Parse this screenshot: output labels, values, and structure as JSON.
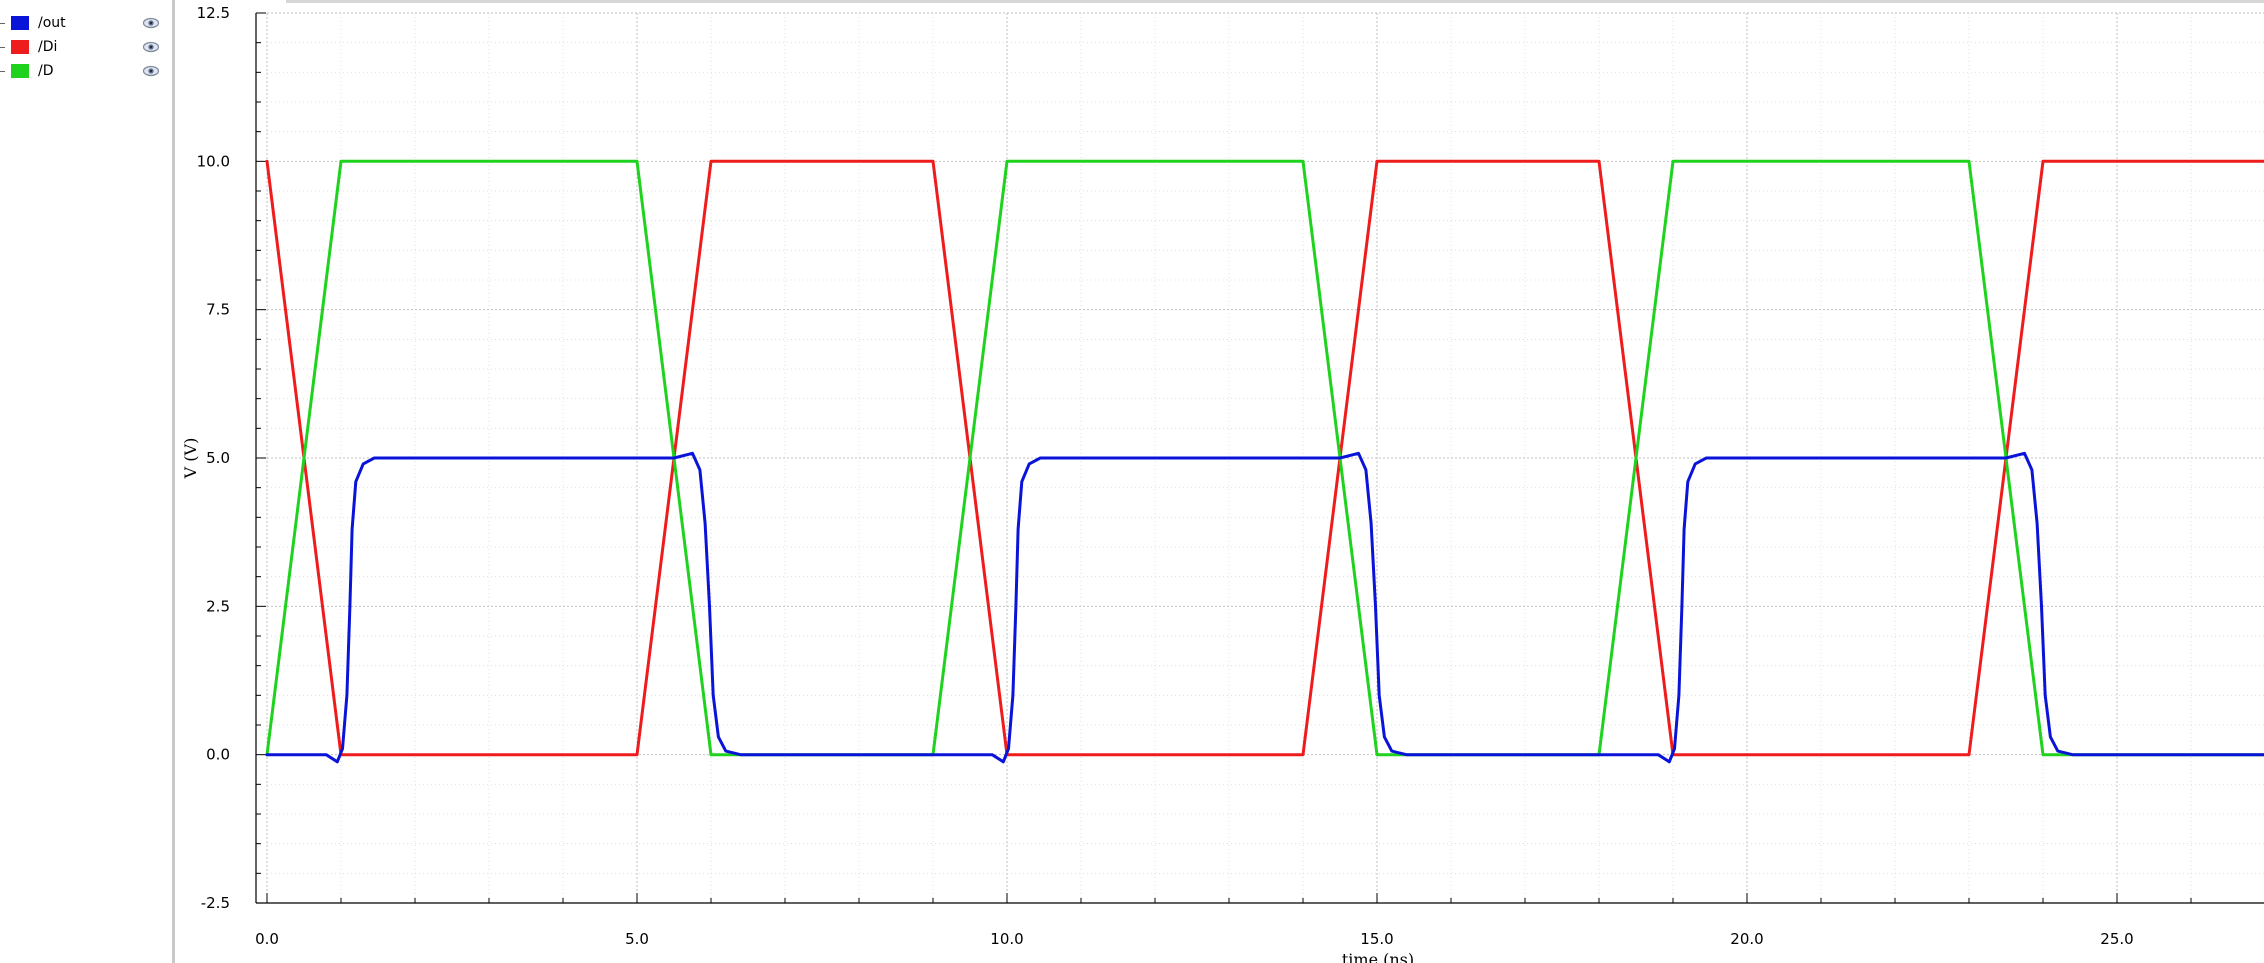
{
  "legend": {
    "items": [
      {
        "label": "/out",
        "color": "#0a14d8",
        "icon": "eye-icon"
      },
      {
        "label": "/Di",
        "color": "#ee1c1c",
        "icon": "eye-icon"
      },
      {
        "label": "/D",
        "color": "#1ed21e",
        "icon": "eye-icon"
      }
    ]
  },
  "chart_data": {
    "type": "line",
    "title": "",
    "xlabel": "time (ns)",
    "ylabel": "V (V)",
    "xlim": [
      0,
      27
    ],
    "ylim": [
      -2.5,
      12.5
    ],
    "x_ticks": [
      0.0,
      5.0,
      10.0,
      15.0,
      20.0,
      25.0
    ],
    "x_tick_labels": [
      "0.0",
      "5.0",
      "10.0",
      "15.0",
      "20.0",
      "25.0"
    ],
    "y_ticks": [
      -2.5,
      0.0,
      2.5,
      5.0,
      7.5,
      10.0,
      12.5
    ],
    "y_tick_labels": [
      "-2.5",
      "0.0",
      "2.5",
      "5.0",
      "7.5",
      "10.0",
      "12.5"
    ],
    "grid": true,
    "legend_position": "left panel",
    "series": [
      {
        "name": "/out",
        "color": "#0a14d8",
        "x": [
          0,
          0.8,
          0.95,
          1.02,
          1.08,
          1.12,
          1.15,
          1.2,
          1.3,
          1.45,
          2.0,
          5.5,
          5.75,
          5.85,
          5.92,
          5.98,
          6.03,
          6.1,
          6.2,
          6.4,
          9.0,
          9.8,
          9.95,
          10.02,
          10.08,
          10.12,
          10.15,
          10.2,
          10.3,
          10.45,
          11.0,
          14.5,
          14.75,
          14.85,
          14.92,
          14.98,
          15.03,
          15.1,
          15.2,
          15.4,
          18.0,
          18.8,
          18.95,
          19.02,
          19.08,
          19.12,
          19.15,
          19.2,
          19.3,
          19.45,
          20.0,
          23.5,
          23.75,
          23.85,
          23.92,
          23.98,
          24.03,
          24.1,
          24.2,
          24.4,
          27.0
        ],
        "y": [
          0,
          0,
          -0.12,
          0.1,
          1.0,
          2.5,
          3.8,
          4.6,
          4.9,
          5.0,
          5.0,
          5.0,
          5.08,
          4.8,
          3.9,
          2.5,
          1.0,
          0.3,
          0.06,
          0,
          0,
          0,
          -0.12,
          0.1,
          1.0,
          2.5,
          3.8,
          4.6,
          4.9,
          5.0,
          5.0,
          5.0,
          5.08,
          4.8,
          3.9,
          2.5,
          1.0,
          0.3,
          0.06,
          0,
          0,
          0,
          -0.12,
          0.1,
          1.0,
          2.5,
          3.8,
          4.6,
          4.9,
          5.0,
          5.0,
          5.0,
          5.08,
          4.8,
          3.9,
          2.5,
          1.0,
          0.3,
          0.06,
          0,
          0
        ]
      },
      {
        "name": "/Di",
        "color": "#ee1c1c",
        "x": [
          0,
          1,
          5,
          6,
          9,
          10,
          14,
          15,
          18,
          19,
          23,
          24,
          27
        ],
        "y": [
          10,
          0,
          0,
          10,
          10,
          0,
          0,
          10,
          10,
          0,
          0,
          10,
          10
        ]
      },
      {
        "name": "/D",
        "color": "#1ed21e",
        "x": [
          0,
          1,
          5,
          6,
          9,
          10,
          14,
          15,
          18,
          19,
          23,
          24,
          27
        ],
        "y": [
          0,
          10,
          10,
          0,
          0,
          10,
          10,
          0,
          0,
          10,
          10,
          0,
          0
        ]
      }
    ]
  }
}
